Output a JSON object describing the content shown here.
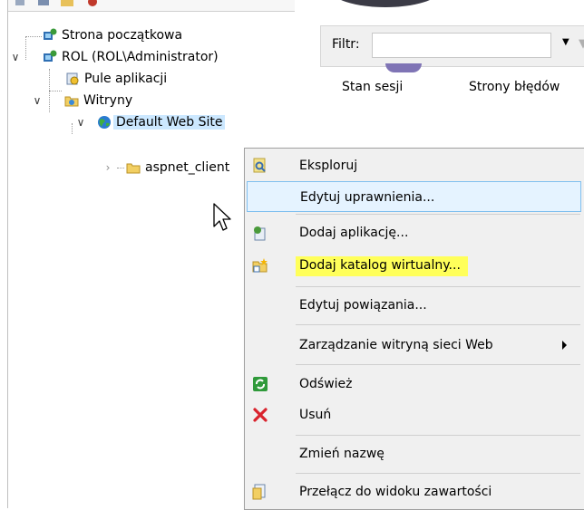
{
  "tree": {
    "items": [
      {
        "label": "Strona początkowa",
        "icon": "start-page-icon"
      },
      {
        "label": "ROL (ROL\\Administrator)",
        "icon": "server-icon"
      },
      {
        "label": "Pule aplikacji",
        "icon": "app-pools-icon"
      },
      {
        "label": "Witryny",
        "icon": "sites-folder-icon"
      },
      {
        "label": "Default Web Site",
        "icon": "globe-icon"
      },
      {
        "label": "aspnet_client",
        "icon": "folder-icon"
      }
    ]
  },
  "filter": {
    "label": "Filtr:",
    "value": ""
  },
  "features": [
    "Stan sesji",
    "Strony błędów"
  ],
  "context_menu": {
    "items": [
      {
        "label": "Eksploruj",
        "icon": "explore-icon"
      },
      {
        "label": "Edytuj uprawnienia...",
        "state": "hover"
      },
      {
        "label": "Dodaj aplikację...",
        "icon": "add-application-icon"
      },
      {
        "label": "Dodaj katalog wirtualny...",
        "icon": "add-virtual-directory-icon",
        "highlighted": true
      },
      {
        "label": "Edytuj powiązania..."
      },
      {
        "label": "Zarządzanie witryną sieci Web",
        "submenu": true
      },
      {
        "label": "Odśwież",
        "icon": "refresh-icon"
      },
      {
        "label": "Usuń",
        "icon": "delete-icon"
      },
      {
        "label": "Zmień nazwę"
      },
      {
        "label": "Przełącz do widoku zawartości",
        "icon": "content-view-icon"
      }
    ]
  },
  "colors": {
    "selection": "#cce8ff",
    "menu_hover": "#e5f3ff",
    "highlight": "#ffff5a",
    "delete_red": "#d9232d"
  }
}
